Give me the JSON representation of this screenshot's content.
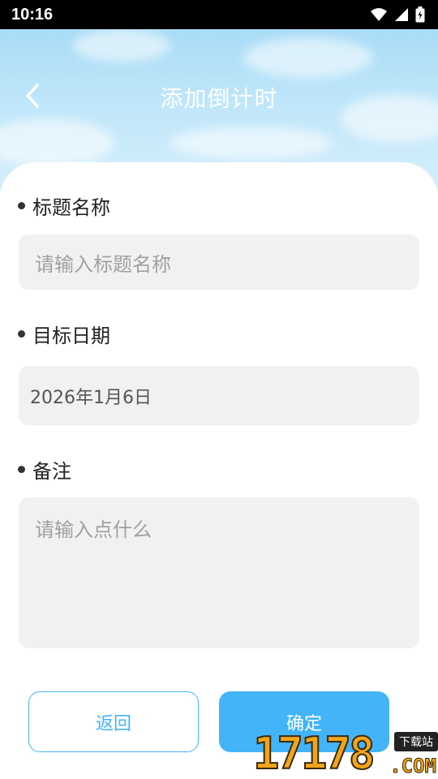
{
  "status_bar": {
    "time": "10:16",
    "icons": [
      "wifi-icon",
      "signal-icon",
      "battery-charging-icon"
    ]
  },
  "header": {
    "title": "添加倒计时",
    "back_icon": "chevron-left-icon"
  },
  "form": {
    "title_field": {
      "label": "标题名称",
      "placeholder": "请输入标题名称",
      "value": ""
    },
    "date_field": {
      "label": "目标日期",
      "value": "2026年1月6日"
    },
    "note_field": {
      "label": "备注",
      "placeholder": "请输入点什么",
      "value": ""
    }
  },
  "buttons": {
    "back_label": "返回",
    "confirm_label": "确定"
  },
  "watermark": {
    "number": "17178",
    "tag": "下载站",
    "suffix": ".COM"
  },
  "colors": {
    "accent": "#42b4f7",
    "header_sky": "#a9dcf6",
    "input_bg": "#f1f1f1",
    "status_bar": "#000000"
  }
}
